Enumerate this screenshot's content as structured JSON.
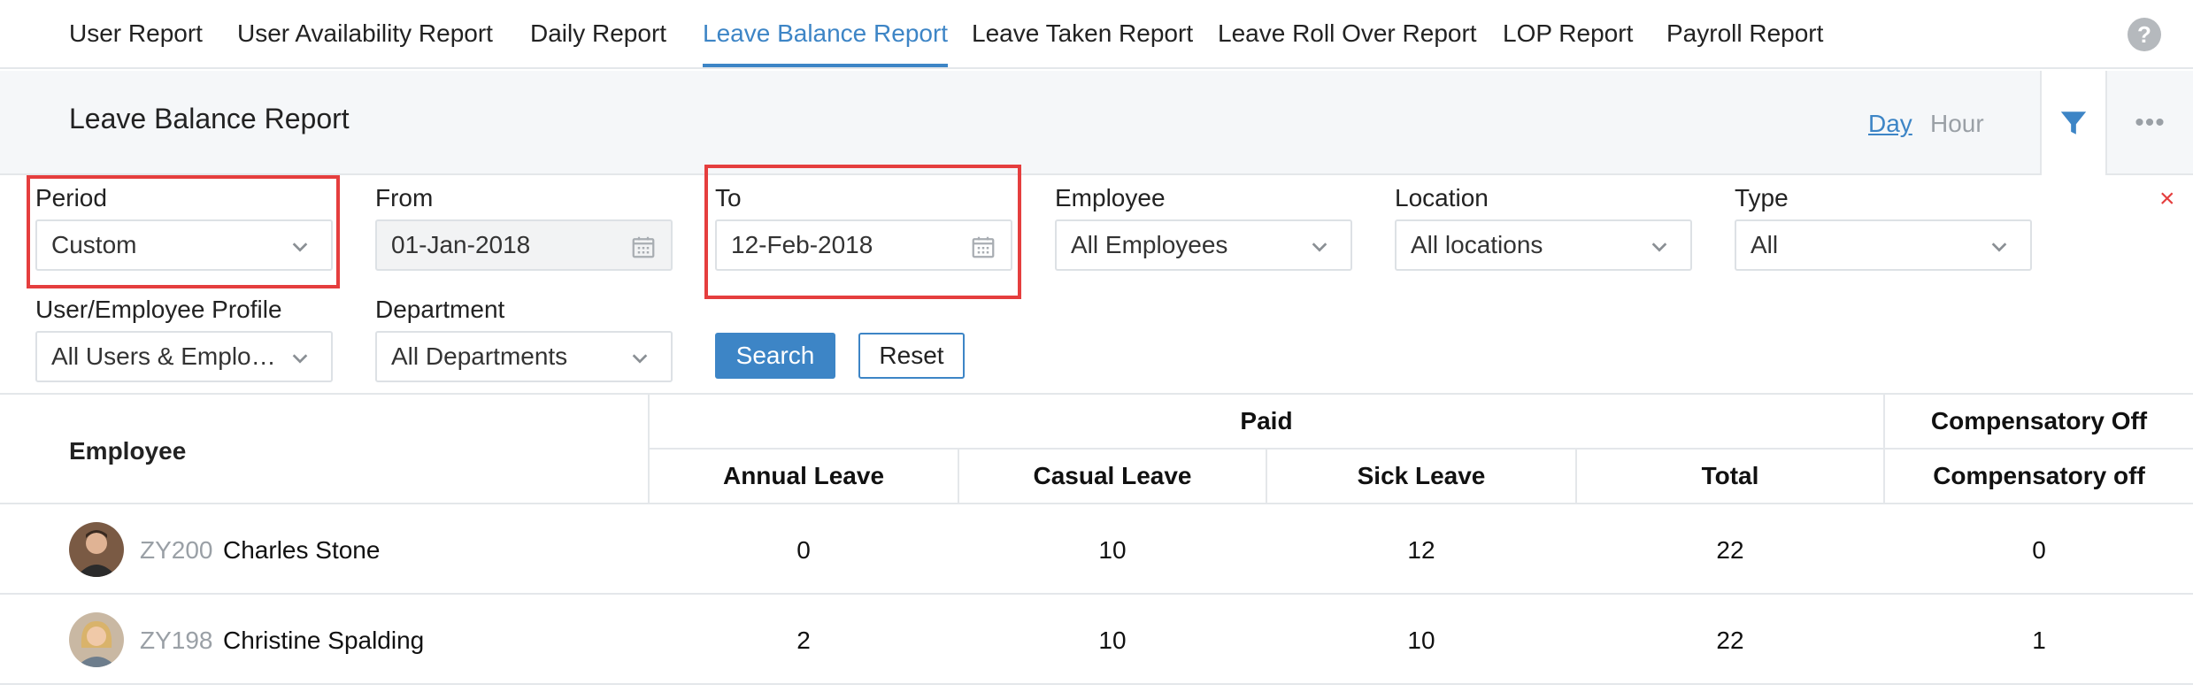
{
  "tabs": [
    {
      "label": "User Report"
    },
    {
      "label": "User Availability Report"
    },
    {
      "label": "Daily Report"
    },
    {
      "label": "Leave Balance Report"
    },
    {
      "label": "Leave Taken Report"
    },
    {
      "label": "Leave Roll Over Report"
    },
    {
      "label": "LOP Report"
    },
    {
      "label": "Payroll Report"
    }
  ],
  "active_tab": "Leave Balance Report",
  "help_glyph": "?",
  "header": {
    "title": "Leave Balance Report",
    "mode_day": "Day",
    "mode_hour": "Hour",
    "more_glyph": "•••"
  },
  "filters": {
    "period": {
      "label": "Period",
      "value": "Custom"
    },
    "from": {
      "label": "From",
      "value": "01-Jan-2018"
    },
    "to": {
      "label": "To",
      "value": "12-Feb-2018"
    },
    "employee": {
      "label": "Employee",
      "value": "All Employees"
    },
    "location": {
      "label": "Location",
      "value": "All locations"
    },
    "type": {
      "label": "Type",
      "value": "All"
    },
    "profile": {
      "label": "User/Employee Profile",
      "value": "All Users & Employees"
    },
    "department": {
      "label": "Department",
      "value": "All Departments"
    },
    "close_glyph": "×",
    "search_label": "Search",
    "reset_label": "Reset"
  },
  "table": {
    "employee_header": "Employee",
    "group_paid": "Paid",
    "group_comp": "Compensatory Off",
    "columns": [
      "Annual Leave",
      "Casual Leave",
      "Sick Leave",
      "Total",
      "Compensatory off"
    ],
    "rows": [
      {
        "id": "ZY200",
        "name": "Charles Stone",
        "values": [
          "0",
          "10",
          "12",
          "22",
          "0"
        ]
      },
      {
        "id": "ZY198",
        "name": "Christine Spalding",
        "values": [
          "2",
          "10",
          "10",
          "22",
          "1"
        ]
      }
    ]
  },
  "colors": {
    "accent": "#3d85c6",
    "highlight": "#e53e3e",
    "muted": "#9aa0a6"
  }
}
